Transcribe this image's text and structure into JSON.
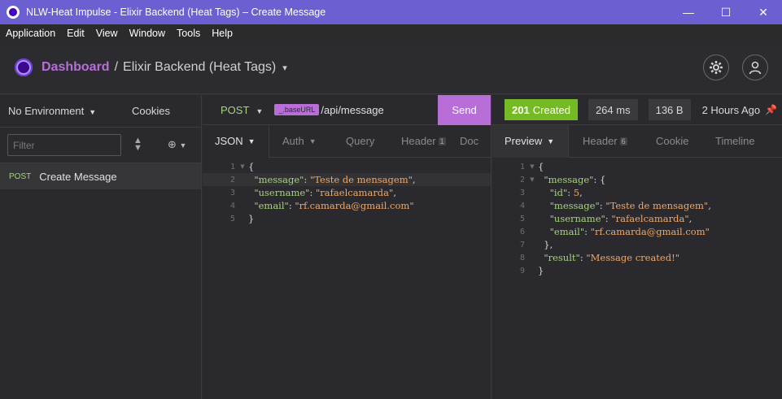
{
  "window": {
    "title": "NLW-Heat Impulse - Elixir Backend (Heat Tags) – Create Message",
    "min": "—",
    "max": "☐",
    "close": "✕"
  },
  "menu": [
    "Application",
    "Edit",
    "View",
    "Window",
    "Tools",
    "Help"
  ],
  "header": {
    "dashboard": "Dashboard",
    "separator": "/",
    "project": "Elixir Backend (Heat Tags)",
    "caret": "▾"
  },
  "sidebar": {
    "environment": "No Environment",
    "cookies": "Cookies",
    "filter_placeholder": "Filter",
    "requests": [
      {
        "method": "POST",
        "name": "Create Message"
      }
    ]
  },
  "request": {
    "method": "POST",
    "url_variable": "_.baseURL",
    "url_path": "/api/message",
    "send_label": "Send",
    "tabs": [
      {
        "label": "JSON",
        "active": true
      },
      {
        "label": "Auth"
      },
      {
        "label": "Query"
      },
      {
        "label": "Header",
        "count": "1"
      },
      {
        "label": "Doc"
      }
    ],
    "body_lines": [
      {
        "n": "1",
        "fold": true,
        "parts": [
          [
            "p",
            "{"
          ]
        ]
      },
      {
        "n": "2",
        "parts": [
          [
            "p",
            "  "
          ],
          [
            "k",
            "\"message\""
          ],
          [
            "p",
            ": "
          ],
          [
            "s",
            "\"Teste de mensagem\""
          ],
          [
            "p",
            ","
          ]
        ]
      },
      {
        "n": "3",
        "parts": [
          [
            "p",
            "  "
          ],
          [
            "k",
            "\"username\""
          ],
          [
            "p",
            ": "
          ],
          [
            "s",
            "\"rafaelcamarda\""
          ],
          [
            "p",
            ","
          ]
        ]
      },
      {
        "n": "4",
        "parts": [
          [
            "p",
            "  "
          ],
          [
            "k",
            "\"email\""
          ],
          [
            "p",
            ": "
          ],
          [
            "s",
            "\"rf.camarda@gmail.com\""
          ]
        ]
      },
      {
        "n": "5",
        "parts": [
          [
            "p",
            "}"
          ]
        ]
      }
    ]
  },
  "response": {
    "status_code": "201",
    "status_text": "Created",
    "time": "264 ms",
    "size": "136 B",
    "ago": "2 Hours Ago",
    "tabs": [
      {
        "label": "Preview",
        "active": true
      },
      {
        "label": "Header",
        "count": "6"
      },
      {
        "label": "Cookie"
      },
      {
        "label": "Timeline"
      }
    ],
    "body_lines": [
      {
        "n": "1",
        "fold": true,
        "parts": [
          [
            "p",
            "{"
          ]
        ]
      },
      {
        "n": "2",
        "fold": true,
        "parts": [
          [
            "p",
            "  "
          ],
          [
            "k",
            "\"message\""
          ],
          [
            "p",
            ": {"
          ]
        ]
      },
      {
        "n": "3",
        "parts": [
          [
            "p",
            "    "
          ],
          [
            "k",
            "\"id\""
          ],
          [
            "p",
            ": "
          ],
          [
            "n",
            "5"
          ],
          [
            "p",
            ","
          ]
        ]
      },
      {
        "n": "4",
        "parts": [
          [
            "p",
            "    "
          ],
          [
            "k",
            "\"message\""
          ],
          [
            "p",
            ": "
          ],
          [
            "s",
            "\"Teste de mensagem\""
          ],
          [
            "p",
            ","
          ]
        ]
      },
      {
        "n": "5",
        "parts": [
          [
            "p",
            "    "
          ],
          [
            "k",
            "\"username\""
          ],
          [
            "p",
            ": "
          ],
          [
            "s",
            "\"rafaelcamarda\""
          ],
          [
            "p",
            ","
          ]
        ]
      },
      {
        "n": "6",
        "parts": [
          [
            "p",
            "    "
          ],
          [
            "k",
            "\"email\""
          ],
          [
            "p",
            ": "
          ],
          [
            "s",
            "\"rf.camarda@gmail.com\""
          ]
        ]
      },
      {
        "n": "7",
        "parts": [
          [
            "p",
            "  },"
          ]
        ]
      },
      {
        "n": "8",
        "parts": [
          [
            "p",
            "  "
          ],
          [
            "k",
            "\"result\""
          ],
          [
            "p",
            ": "
          ],
          [
            "s",
            "\"Message created!\""
          ]
        ]
      },
      {
        "n": "9",
        "parts": [
          [
            "p",
            "}"
          ]
        ]
      }
    ]
  },
  "colors": {
    "titlebar": "#6b5fd1",
    "accent": "#b76ed7",
    "success": "#75ba24",
    "json_key": "#a6d37c",
    "json_string": "#f2a765"
  }
}
